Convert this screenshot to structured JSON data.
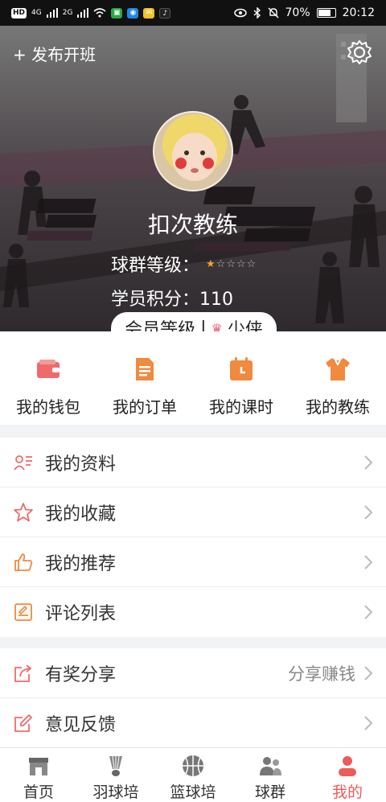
{
  "status_bar": {
    "network_left": "HD",
    "signal1": "4G",
    "signal2": "2G",
    "battery": "70%",
    "time": "20:12"
  },
  "header": {
    "publish_label": "+ 发布开班",
    "settings_icon": "gear-icon"
  },
  "profile": {
    "name": "扣次教练",
    "group_level_label": "球群等级：",
    "stars_filled": 1,
    "stars_total": 5,
    "points_label": "学员积分：110",
    "member_level_label": "会员等级",
    "member_separator": "|",
    "member_level_value": "少侠"
  },
  "quick_actions": [
    {
      "label": "我的钱包",
      "icon": "wallet-icon"
    },
    {
      "label": "我的订单",
      "icon": "order-icon"
    },
    {
      "label": "我的课时",
      "icon": "calendar-icon"
    },
    {
      "label": "我的教练",
      "icon": "jersey-icon"
    }
  ],
  "menu_group1": [
    {
      "label": "我的资料",
      "icon": "profile-card-icon"
    },
    {
      "label": "我的收藏",
      "icon": "star-icon"
    },
    {
      "label": "我的推荐",
      "icon": "thumbs-up-icon"
    },
    {
      "label": "评论列表",
      "icon": "comment-list-icon"
    }
  ],
  "menu_group2": [
    {
      "label": "有奖分享",
      "icon": "share-icon",
      "extra": "分享赚钱"
    },
    {
      "label": "意见反馈",
      "icon": "feedback-icon",
      "extra": ""
    }
  ],
  "tabs": [
    {
      "label": "首页",
      "icon": "home-icon",
      "active": false
    },
    {
      "label": "羽球培",
      "icon": "shuttlecock-icon",
      "active": false
    },
    {
      "label": "篮球培",
      "icon": "basketball-icon",
      "active": false
    },
    {
      "label": "球群",
      "icon": "group-icon",
      "active": false
    },
    {
      "label": "我的",
      "icon": "user-icon",
      "active": true
    }
  ],
  "colors": {
    "accent": "#ef5a5a",
    "icon_red": "#ef6b6b",
    "icon_orange": "#f08a3e",
    "star": "#f5a623"
  }
}
